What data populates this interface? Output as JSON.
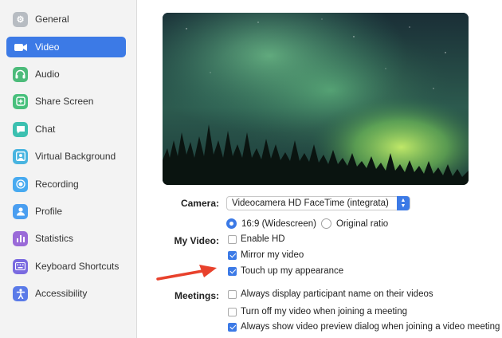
{
  "sidebar": {
    "items": [
      {
        "label": "General",
        "icon": "gear-icon",
        "color": "#9aa0a6",
        "glyph": "⚙"
      },
      {
        "label": "Video",
        "icon": "video-camera-icon",
        "color": "#ffffff",
        "glyph": "▶"
      },
      {
        "label": "Audio",
        "icon": "headphones-icon",
        "color": "#4cbb7a",
        "glyph": "♫"
      },
      {
        "label": "Share Screen",
        "icon": "share-screen-icon",
        "color": "#48c07c",
        "glyph": "+"
      },
      {
        "label": "Chat",
        "icon": "chat-icon",
        "color": "#3cc0b0",
        "glyph": "▪"
      },
      {
        "label": "Virtual Background",
        "icon": "person-background-icon",
        "color": "#48b4e0",
        "glyph": "▣"
      },
      {
        "label": "Recording",
        "icon": "record-icon",
        "color": "#48aaf0",
        "glyph": "◉"
      },
      {
        "label": "Profile",
        "icon": "profile-icon",
        "color": "#4a9ef0",
        "glyph": "●"
      },
      {
        "label": "Statistics",
        "icon": "statistics-icon",
        "color": "#9a6ad8",
        "glyph": "▮"
      },
      {
        "label": "Keyboard Shortcuts",
        "icon": "keyboard-icon",
        "color": "#7a6ae0",
        "glyph": "⌨"
      },
      {
        "label": "Accessibility",
        "icon": "accessibility-icon",
        "color": "#5a7ae8",
        "glyph": "♿"
      }
    ],
    "active_index": 1,
    "active_color": "#3c7ae6"
  },
  "camera": {
    "label": "Camera:",
    "selected": "Videocamera HD FaceTime (integrata)"
  },
  "my_video": {
    "label": "My Video:",
    "ratio_widescreen": "16:9 (Widescreen)",
    "ratio_original": "Original ratio",
    "enable_hd": "Enable HD",
    "mirror": "Mirror my video",
    "touch_up": "Touch up my appearance"
  },
  "meetings": {
    "label": "Meetings:",
    "display_name": "Always display participant name on their videos",
    "turn_off": "Turn off my video when joining a meeting",
    "show_preview": "Always show video preview dialog when joining a video meeting"
  },
  "annotation_arrow_color": "#e8412c"
}
